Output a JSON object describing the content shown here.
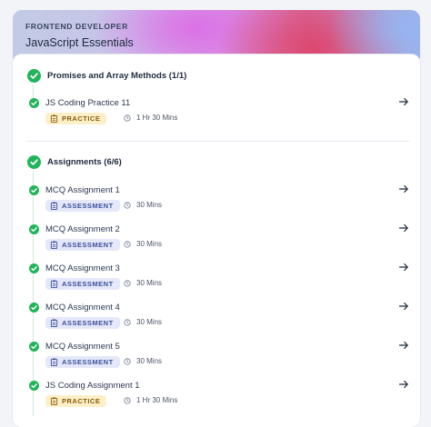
{
  "course": {
    "category": "FRONTEND DEVELOPER",
    "title": "JavaScript Essentials"
  },
  "sections": [
    {
      "title": "Promises and Array Methods (1/1)",
      "items": [
        {
          "title": "JS Coding Practice 11",
          "badge": "PRACTICE",
          "badge_type": "practice",
          "duration": "1 Hr 30 Mins"
        }
      ]
    },
    {
      "title": "Assignments (6/6)",
      "items": [
        {
          "title": "MCQ Assignment 1",
          "badge": "ASSESSMENT",
          "badge_type": "assessment",
          "duration": "30 Mins"
        },
        {
          "title": "MCQ Assignment 2",
          "badge": "ASSESSMENT",
          "badge_type": "assessment",
          "duration": "30 Mins"
        },
        {
          "title": "MCQ Assignment 3",
          "badge": "ASSESSMENT",
          "badge_type": "assessment",
          "duration": "30 Mins"
        },
        {
          "title": "MCQ Assignment 4",
          "badge": "ASSESSMENT",
          "badge_type": "assessment",
          "duration": "30 Mins"
        },
        {
          "title": "MCQ Assignment 5",
          "badge": "ASSESSMENT",
          "badge_type": "assessment",
          "duration": "30 Mins"
        },
        {
          "title": "JS Coding Assignment 1",
          "badge": "PRACTICE",
          "badge_type": "practice",
          "duration": "1 Hr 30 Mins"
        }
      ]
    }
  ],
  "icons": {
    "completed": "check-circle-icon",
    "badge": "clipboard-icon",
    "duration": "clock-icon",
    "open": "arrow-right-icon"
  },
  "colors": {
    "success": "#22b45a",
    "practice_bg": "#fdf0c8",
    "practice_text": "#8a5a0d",
    "assessment_bg": "#e4e8fa",
    "assessment_text": "#3d4f9a"
  }
}
